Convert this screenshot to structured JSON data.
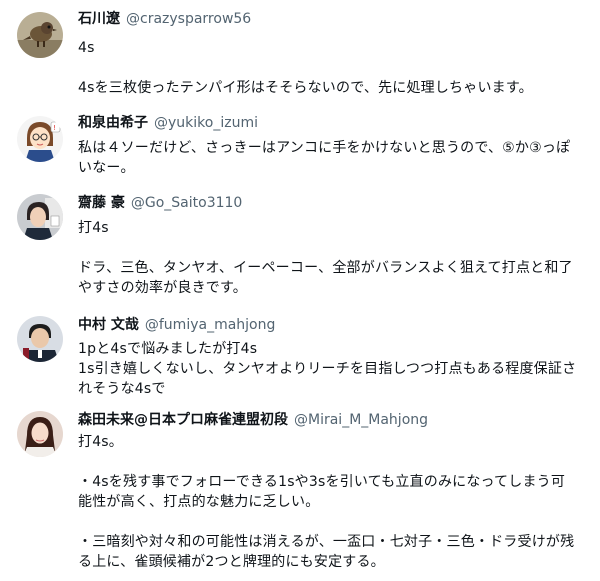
{
  "tweets": [
    {
      "name": "石川遼",
      "handle": "@crazysparrow56",
      "body": "4s\n\n4sを三枚使ったテンパイ形はそそらないので、先に処理しちゃいます。"
    },
    {
      "name": "和泉由希子",
      "handle": "@yukiko_izumi",
      "body": "私は４ソーだけど、さっきーはアンコに手をかけないと思うので、⑤か③っぽいなー。"
    },
    {
      "name": "齋藤 豪",
      "handle": "@Go_Saito3110",
      "body": "打4s\n\nドラ、三色、タンヤオ、イーペーコー、全部がバランスよく狙えて打点と和了やすさの効率が良きです。"
    },
    {
      "name": "中村 文哉",
      "handle": "@fumiya_mahjong",
      "body": "1pと4sで悩みましたが打4s\n1s引き嬉しくないし、タンヤオよりリーチを目指しつつ打点もある程度保証されそうな4sで"
    },
    {
      "name": "森田未来@日本プロ麻雀連盟初段",
      "handle": "@Mirai_M_Mahjong",
      "body": "打4s。\n\n・4sを残す事でフォローできる1sや3sを引いても立直のみになってしまう可能性が高く、打点的な魅力に乏しい。\n\n・三暗刻や対々和の可能性は消えるが、一盃口・七対子・三色・ドラ受けが残る上に、雀頭候補が2つと牌理的にも安定する。"
    }
  ],
  "colors": {
    "name": "#0f1419",
    "handle": "#536471",
    "background": "#ffffff"
  }
}
